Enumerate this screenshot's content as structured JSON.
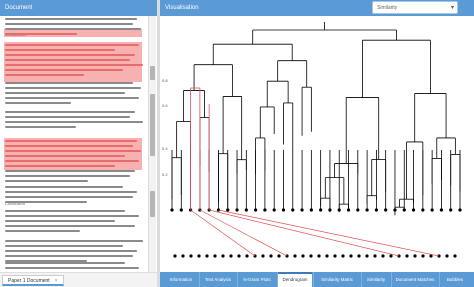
{
  "document_panel": {
    "title": "Document",
    "section_headers": [
      "Introduction",
      "Conclusion"
    ],
    "tab": {
      "label": "Paper 1 Document",
      "close": "×"
    }
  },
  "visualisation_panel": {
    "title": "Visualisation",
    "select": {
      "value": "Similarity"
    },
    "axis_ticks": [
      "0.8",
      "0.6",
      "0.4",
      "0.2"
    ]
  },
  "bottom_tabs": [
    {
      "label": "Information",
      "active": false
    },
    {
      "label": "Text Analysis",
      "active": false
    },
    {
      "label": "N-Gram Plots",
      "active": false
    },
    {
      "label": "Dendrogram",
      "active": true
    },
    {
      "label": "Similarity Matrix",
      "active": false
    },
    {
      "label": "Similarity",
      "active": false
    },
    {
      "label": "Document Matches",
      "active": false
    },
    {
      "label": "Bubbles",
      "active": false
    }
  ],
  "colors": {
    "header": "#5b9bd5",
    "highlight": "#f7b1b1",
    "highlight_text": "#e86c6c",
    "match_line": "#e05555"
  }
}
